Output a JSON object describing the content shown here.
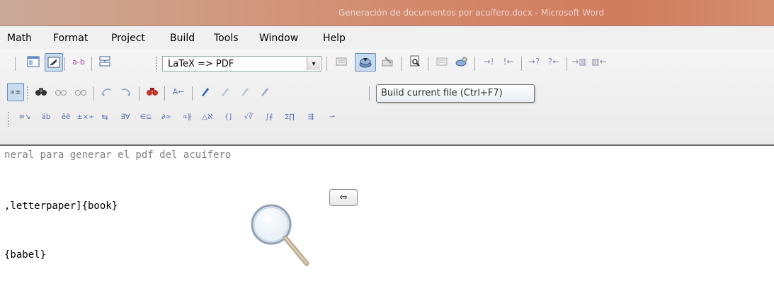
{
  "window": {
    "title": "Generación de documentos por acuífero.docx - Microsoft Word"
  },
  "menubar": {
    "items": [
      {
        "label": "Math"
      },
      {
        "label": "Format"
      },
      {
        "label": "Project"
      },
      {
        "label": "Build"
      },
      {
        "label": "Tools"
      },
      {
        "label": "Window"
      },
      {
        "label": "Help"
      }
    ]
  },
  "toolbar": {
    "row1": {
      "toggle_label": "a-b",
      "build_mode": "LaTeX => PDF",
      "combo_arrow": "▾",
      "marks": [
        "→!",
        "!←",
        "→?",
        "?←",
        "→▥",
        "▥←"
      ]
    },
    "row2": {
      "find_label": "A←"
    },
    "row3": {
      "symbols": [
        "≡↘",
        "äb",
        "ěẽ",
        "±×÷",
        "⇆",
        "∃∀",
        "∈⊆",
        "∂∞",
        "∝∦",
        "△ℵ",
        "{⌋",
        "√∛",
        "∫∮",
        "Σ∏",
        "⇶",
        "⇀"
      ]
    }
  },
  "tooltip": {
    "text": "Build current file (Ctrl+F7)"
  },
  "editor": {
    "lines": [
      "neral para generar el pdf del acuífero",
      ",letterpaper]{book}",
      "{babel}"
    ],
    "mini_button": "⇔"
  },
  "colors": {
    "title_bar": "#d3886c",
    "menubar": "#f0f0f0",
    "comment": "#808080",
    "pressed": "#c8dcf0"
  }
}
